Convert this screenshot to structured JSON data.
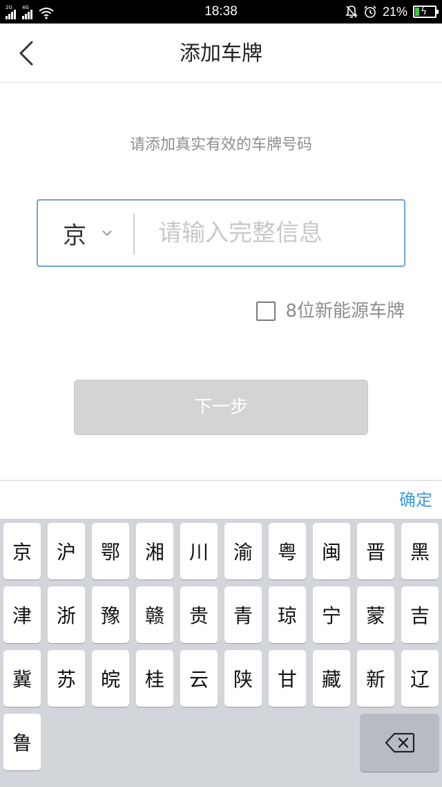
{
  "status_bar": {
    "time": "18:38",
    "sim1_tag": "2G",
    "sim2_tag": "4G",
    "battery_percent": "21%",
    "battery_level": 0.21,
    "battery_color": "#37d03a"
  },
  "header": {
    "title": "添加车牌",
    "back_icon": "chevron-left-icon"
  },
  "main": {
    "hint": "请添加真实有效的车牌号码",
    "province": "京",
    "plate_placeholder": "请输入完整信息",
    "plate_value": "",
    "nev_checked": false,
    "nev_label": "8位新能源车牌",
    "next_label": "下一步"
  },
  "keyboard": {
    "confirm_label": "确定",
    "confirm_color": "#3f9be0",
    "rows": [
      [
        "京",
        "沪",
        "鄂",
        "湘",
        "川",
        "渝",
        "粤",
        "闽",
        "晋",
        "黑"
      ],
      [
        "津",
        "浙",
        "豫",
        "赣",
        "贵",
        "青",
        "琼",
        "宁",
        "蒙",
        "吉"
      ],
      [
        "冀",
        "苏",
        "皖",
        "桂",
        "云",
        "陕",
        "甘",
        "藏",
        "新",
        "辽"
      ],
      [
        "鲁"
      ]
    ],
    "delete_icon": "backspace-icon"
  }
}
